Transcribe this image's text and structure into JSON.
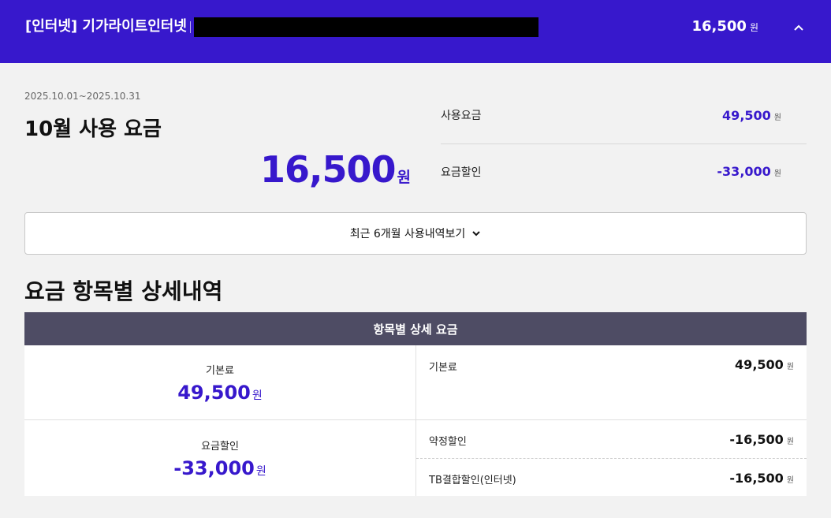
{
  "header": {
    "title": "[인터넷] 기가라이트인터넷",
    "total_amount": "16,500",
    "unit": "원"
  },
  "summary": {
    "period": "2025.10.01~2025.10.31",
    "title": "10월 사용 요금",
    "total_amount": "16,500",
    "unit": "원",
    "rows": [
      {
        "label": "사용요금",
        "value": "49,500",
        "unit": "원"
      },
      {
        "label": "요금할인",
        "value": "-33,000",
        "unit": "원"
      }
    ]
  },
  "history_button": {
    "label": "최근 6개월 사용내역보기"
  },
  "details": {
    "section_title": "요금 항목별 상세내역",
    "table_header": "항목별 상세 요금",
    "groups": [
      {
        "label": "기본료",
        "amount": "49,500",
        "unit": "원",
        "items": [
          {
            "label": "기본료",
            "value": "49,500",
            "unit": "원"
          }
        ]
      },
      {
        "label": "요금할인",
        "amount": "-33,000",
        "unit": "원",
        "items": [
          {
            "label": "약정할인",
            "value": "-16,500",
            "unit": "원"
          },
          {
            "label": "TB결합할인(인터넷)",
            "value": "-16,500",
            "unit": "원"
          }
        ]
      }
    ]
  },
  "colors": {
    "accent": "#3718cc",
    "table_header_bg": "#4e4c64",
    "page_bg": "#f2f2f2"
  },
  "icons": {
    "collapse": "chevron-up-icon",
    "expand": "chevron-down-icon"
  }
}
